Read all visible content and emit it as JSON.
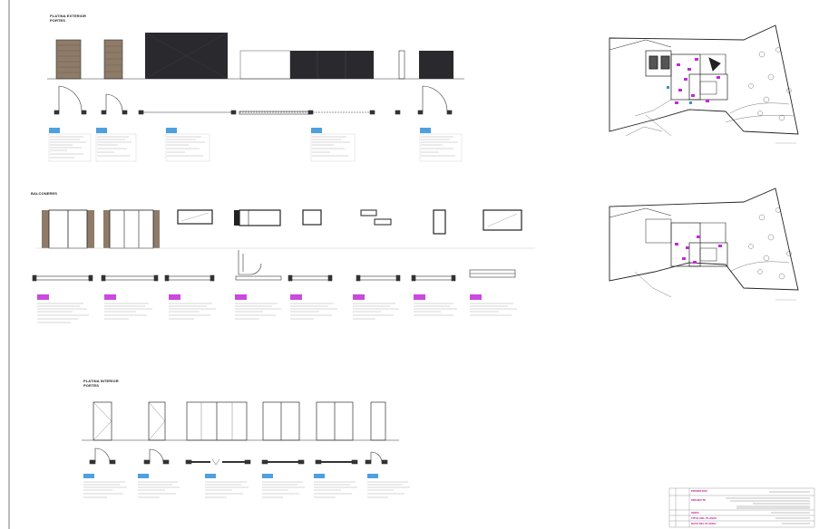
{
  "sections": {
    "exterior_doors": {
      "line1": "PLATINA EXTERIOR",
      "line2": "PORTES"
    },
    "windows": {
      "line1": "BALCONERES"
    },
    "interior_doors": {
      "line1": "PLATINA INTERIOR",
      "line2": "PORTES"
    }
  },
  "title_block": {
    "promotor_label": "PROMOTOR",
    "projecte_label": "PROJECTE",
    "obra_label": "OBRA",
    "row4_label": "TITOL DEL PLANOL",
    "row5_label": "DATA DEL PLANOL"
  },
  "colors": {
    "line": "#2b2b2b",
    "tag": "#2f8fd8",
    "tag_magenta": "#c02ad6",
    "fill_dark": "#2a2a2e",
    "wood": "#8e7b68"
  }
}
